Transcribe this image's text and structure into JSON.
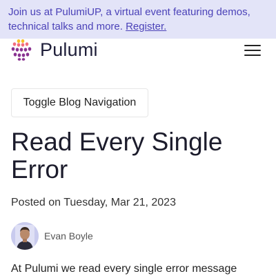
{
  "banner": {
    "text": "Join us at PulumiUP, a virtual event featuring demos, technical talks and more.",
    "link_label": "Register."
  },
  "header": {
    "brand": "Pulumi",
    "logo_icon": "pulumi-logo-icon",
    "menu_icon": "hamburger-menu-icon"
  },
  "blog_nav": {
    "toggle_label": "Toggle Blog Navigation"
  },
  "post": {
    "title": "Read Every Single Error",
    "posted": "Posted on Tuesday, Mar 21, 2023",
    "author": "Evan Boyle",
    "intro": "At Pulumi we read every single error message"
  },
  "colors": {
    "banner_bg": "#e3e4f8",
    "banner_text": "#4b42b8",
    "logo_purple": "#8a3391",
    "logo_yellow": "#f7bf2a",
    "logo_pink": "#f26e7e"
  }
}
